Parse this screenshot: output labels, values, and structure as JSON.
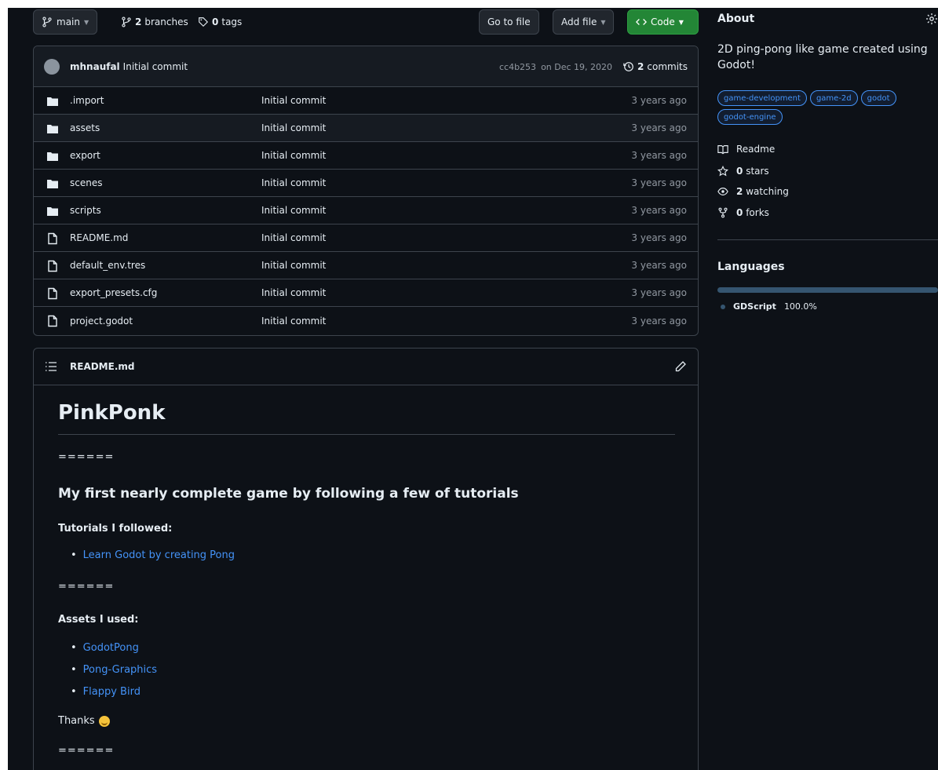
{
  "toolbar": {
    "branch_label": "main",
    "branches_count": "2",
    "branches_label": "branches",
    "tags_count": "0",
    "tags_label": "tags",
    "go_to_file": "Go to file",
    "add_file": "Add file",
    "code": "Code"
  },
  "commit": {
    "author": "mhnaufal",
    "message": "Initial commit",
    "hash": "cc4b253",
    "date": "on Dec 19, 2020",
    "commits_count": "2",
    "commits_label": "commits"
  },
  "files": [
    {
      "name": ".import",
      "type": "folder",
      "message": "Initial commit",
      "age": "3 years ago"
    },
    {
      "name": "assets",
      "type": "folder",
      "message": "Initial commit",
      "age": "3 years ago"
    },
    {
      "name": "export",
      "type": "folder",
      "message": "Initial commit",
      "age": "3 years ago"
    },
    {
      "name": "scenes",
      "type": "folder",
      "message": "Initial commit",
      "age": "3 years ago"
    },
    {
      "name": "scripts",
      "type": "folder",
      "message": "Initial commit",
      "age": "3 years ago"
    },
    {
      "name": "README.md",
      "type": "file",
      "message": "Initial commit",
      "age": "3 years ago"
    },
    {
      "name": "default_env.tres",
      "type": "file",
      "message": "Initial commit",
      "age": "3 years ago"
    },
    {
      "name": "export_presets.cfg",
      "type": "file",
      "message": "Initial commit",
      "age": "3 years ago"
    },
    {
      "name": "project.godot",
      "type": "file",
      "message": "Initial commit",
      "age": "3 years ago"
    }
  ],
  "readme": {
    "header_title": "README.md",
    "h1": "PinkPonk",
    "separator": "======",
    "h2": "My first nearly complete game by following a few of tutorials",
    "tutorials_heading": "Tutorials I followed:",
    "tutorials": [
      "Learn Godot by creating Pong"
    ],
    "assets_heading": "Assets I used:",
    "assets": [
      "GodotPong",
      "Pong-Graphics",
      "Flappy Bird"
    ],
    "thanks": "Thanks"
  },
  "about": {
    "title": "About",
    "description": "2D ping-pong like game created using Godot!",
    "topics": [
      "game-development",
      "game-2d",
      "godot",
      "godot-engine"
    ],
    "readme_label": "Readme",
    "stars_count": "0",
    "stars_label": "stars",
    "watching_count": "2",
    "watching_label": "watching",
    "forks_count": "0",
    "forks_label": "forks"
  },
  "languages": {
    "title": "Languages",
    "items": [
      {
        "name": "GDScript",
        "percent": "100.0%",
        "color": "#355570"
      }
    ]
  },
  "colors": {
    "background": "#0d1117",
    "border": "#3d444d",
    "link": "#4493f8",
    "code_button": "#238636"
  }
}
